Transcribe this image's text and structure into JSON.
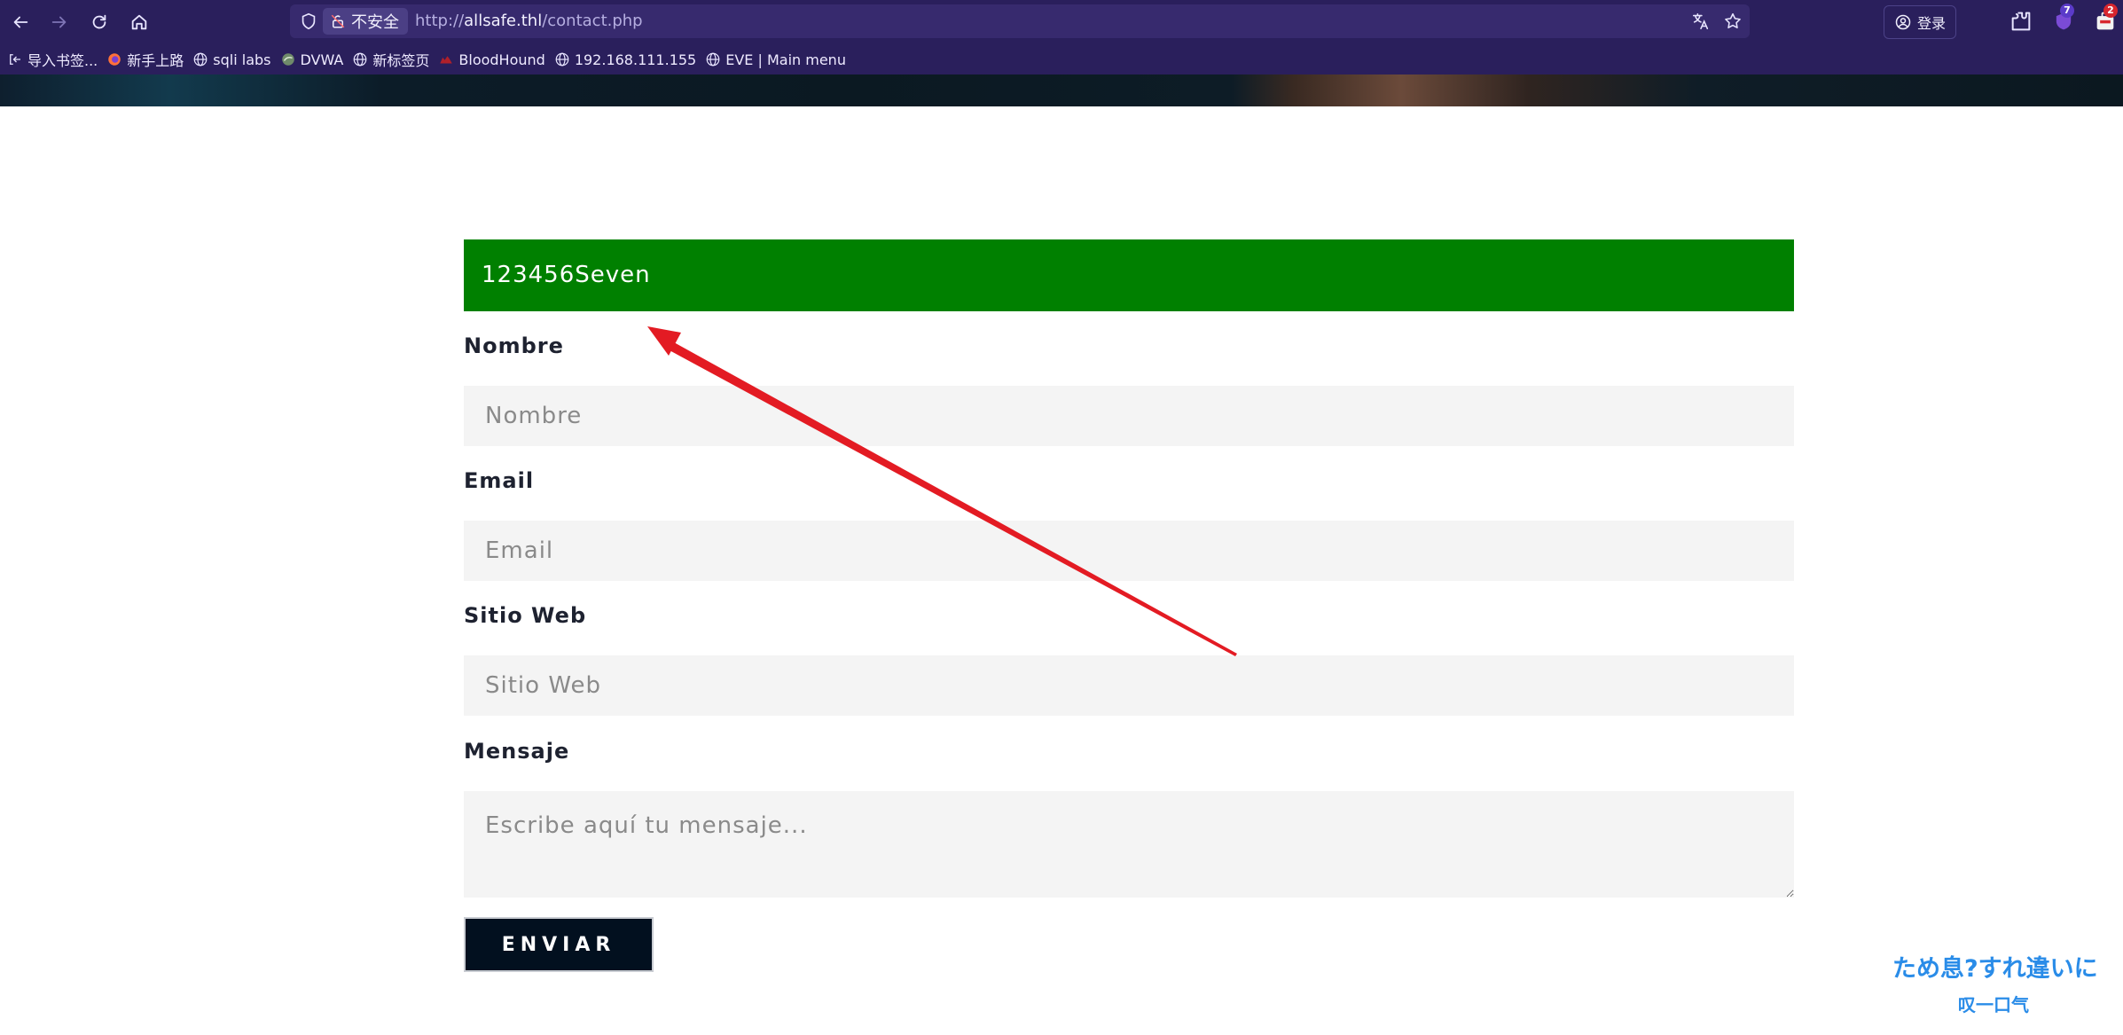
{
  "browser": {
    "url_scheme": "http://",
    "url_host": "allsafe.thl",
    "url_path": "/contact.php",
    "security_label": "不安全",
    "login_label": "登录",
    "extension_badge_1": "7",
    "extension_badge_2": "2",
    "bookmarks": [
      {
        "label": "导入书签...",
        "icon": "import-icon"
      },
      {
        "label": "新手上路",
        "icon": "firefox-icon"
      },
      {
        "label": "sqli labs",
        "icon": "globe-icon"
      },
      {
        "label": "DVWA",
        "icon": "dvwa-icon"
      },
      {
        "label": "新标签页",
        "icon": "globe-icon"
      },
      {
        "label": "BloodHound",
        "icon": "bloodhound-icon"
      },
      {
        "label": "192.168.111.155",
        "icon": "globe-icon"
      },
      {
        "label": "EVE | Main menu",
        "icon": "globe-icon"
      }
    ]
  },
  "form": {
    "alert_text": "123456Seven",
    "alert_color": "#008000",
    "name_label": "Nombre",
    "name_placeholder": "Nombre",
    "email_label": "Email",
    "email_placeholder": "Email",
    "website_label": "Sitio Web",
    "website_placeholder": "Sitio Web",
    "message_label": "Mensaje",
    "message_placeholder": "Escribe aquí tu mensaje...",
    "submit_label": "ENVIAR"
  },
  "annotation": {
    "arrow_color": "#e31b23"
  },
  "watermark": {
    "line1": "ため息?すれ違いに",
    "line2": "叹一口气"
  }
}
